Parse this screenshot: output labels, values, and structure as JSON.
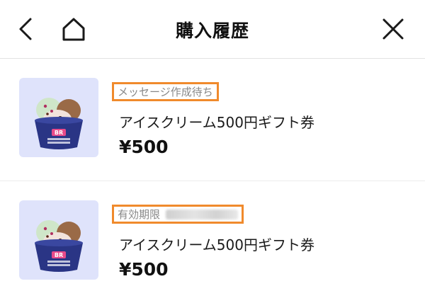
{
  "header": {
    "title": "購入履歴",
    "back_icon": "chevron-left-icon",
    "home_icon": "home-icon",
    "close_icon": "close-icon"
  },
  "colors": {
    "highlight": "#f08a2c",
    "thumb_bg": "#dfe3fb",
    "cup": "#2a3585"
  },
  "items": [
    {
      "status": "メッセージ作成待ち",
      "name": "アイスクリーム500円ギフト券",
      "price": "¥500"
    },
    {
      "status": "有効期限",
      "name": "アイスクリーム500円ギフト券",
      "price": "¥500"
    }
  ]
}
